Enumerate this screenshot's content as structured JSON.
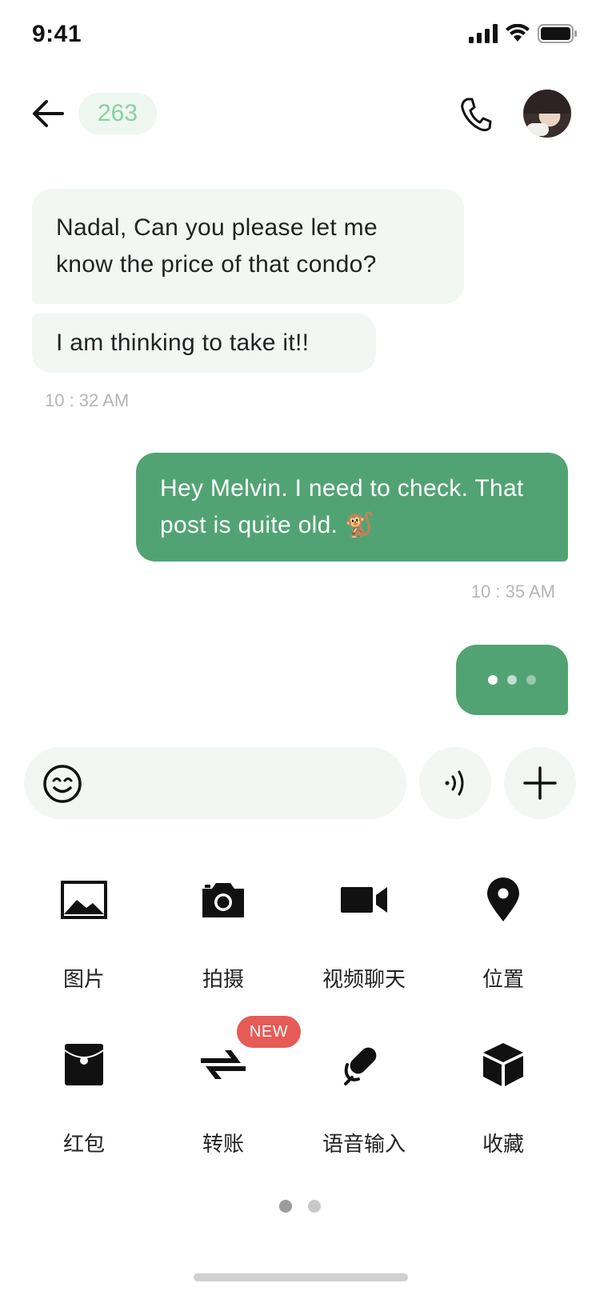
{
  "status_bar": {
    "time": "9:41"
  },
  "header": {
    "count": "263",
    "back_icon": "arrow-left-icon",
    "call_icon": "phone-icon"
  },
  "messages": [
    {
      "direction": "incoming",
      "text": "Nadal, Can you please let me know the price of that condo?"
    },
    {
      "direction": "incoming",
      "text": "I am thinking to take it!!",
      "time": "10 : 32 AM"
    },
    {
      "direction": "outgoing",
      "text": "Hey Melvin. I need to check. That post is quite old. 🐒",
      "time": "10 : 35 AM"
    }
  ],
  "input": {
    "value": "",
    "placeholder": ""
  },
  "actions": [
    {
      "label": "图片",
      "icon": "image-icon"
    },
    {
      "label": "拍摄",
      "icon": "camera-icon"
    },
    {
      "label": "视频聊天",
      "icon": "video-icon"
    },
    {
      "label": "位置",
      "icon": "location-pin-icon"
    },
    {
      "label": "红包",
      "icon": "red-envelope-icon"
    },
    {
      "label": "转账",
      "icon": "transfer-icon",
      "badge": "NEW"
    },
    {
      "label": "语音输入",
      "icon": "microphone-icon"
    },
    {
      "label": "收藏",
      "icon": "favorites-box-icon"
    }
  ],
  "pager": {
    "pages": 2,
    "current": 1
  },
  "colors": {
    "accent": "#52a374",
    "bubble_incoming": "#f3f7f4",
    "badge_red": "#e65b56",
    "count_text": "#8ccfa2"
  }
}
